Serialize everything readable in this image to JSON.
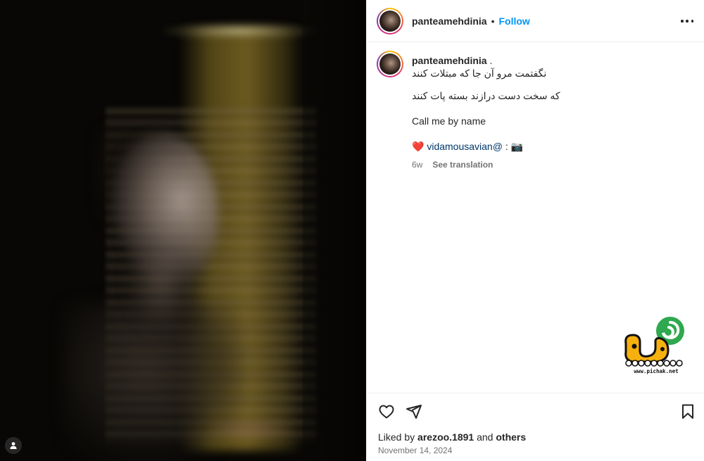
{
  "post": {
    "username": "panteamehdinia",
    "separator": "•",
    "follow_label": "Follow",
    "more_label": "more options"
  },
  "caption": {
    "username": "panteamehdinia",
    "username_suffix": " .",
    "line1": "نگفتمت مرو آن جا که مبتلات کنند",
    "line2": "که سخت دست درازند بسته پات کنند",
    "line3": "Call me by name",
    "heart_emoji": "❤️",
    "mention": "vidamousavian@",
    "mention_suffix": " : 📷",
    "time_ago": "6w",
    "see_translation": "See translation"
  },
  "likes": {
    "prefix": "Liked by ",
    "user": "arezoo.1891",
    "middle": " and ",
    "others": "others"
  },
  "date": "November 14, 2024",
  "watermark": {
    "text": "www.pichak.net"
  },
  "colors": {
    "follow": "#0095f6",
    "mention": "#00376b",
    "muted": "#737373"
  },
  "icons": [
    "heart-icon",
    "share-icon",
    "bookmark-icon",
    "user-tag-icon",
    "more-icon"
  ]
}
